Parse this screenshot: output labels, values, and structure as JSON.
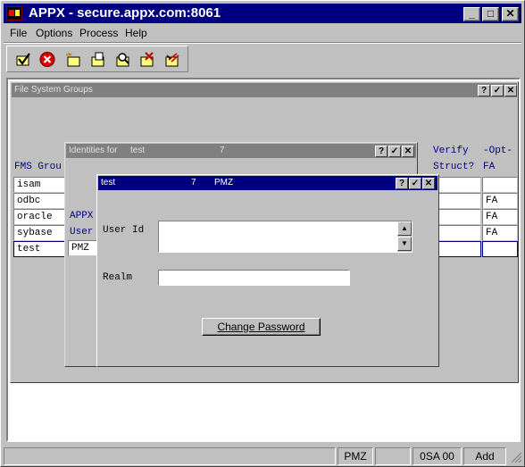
{
  "window": {
    "title": "APPX - secure.appx.com:8061",
    "minimize": "_",
    "maximize": "□",
    "close": "✕"
  },
  "menu": {
    "items": [
      "File",
      "Options",
      "Process",
      "Help"
    ]
  },
  "toolbar": {
    "buttons": [
      "ok-check-icon",
      "cancel-icon",
      "new-record-icon",
      "open-record-icon",
      "find-record-icon",
      "delete-record-icon",
      "clear-record-icon"
    ]
  },
  "fsg": {
    "title": "File System Groups",
    "col1_header": "FMS Grou",
    "col_verify_header_1": "Verify",
    "col_verify_header_2": "Struct?",
    "col_opt_header_1": "-Opt-",
    "col_opt_header_2": "FA",
    "rows": [
      {
        "name": "isam",
        "opt": ""
      },
      {
        "name": "odbc",
        "opt": "FA"
      },
      {
        "name": "oracle",
        "opt": "FA"
      },
      {
        "name": "sybase",
        "opt": "FA"
      },
      {
        "name": "test",
        "opt": ""
      }
    ]
  },
  "identities": {
    "title_prefix": "Identities for",
    "group": "test",
    "number": "7",
    "appx_label": "APPX",
    "user_label": "User",
    "row_value": "PMZ"
  },
  "detail": {
    "title_group": "test",
    "title_number": "7",
    "title_user": "PMZ",
    "user_id_label": "User Id",
    "user_id_value": "",
    "realm_label": "Realm",
    "realm_value": "",
    "change_password": "Change Password"
  },
  "caption_buttons": {
    "help": "?",
    "ok": "✓",
    "close": "✕"
  },
  "statusbar": {
    "user": "PMZ",
    "app": "0SA 00",
    "mode": "Add"
  },
  "colors": {
    "titlebar": "#000080",
    "face": "#c0c0c0",
    "field_header": "#000080"
  }
}
